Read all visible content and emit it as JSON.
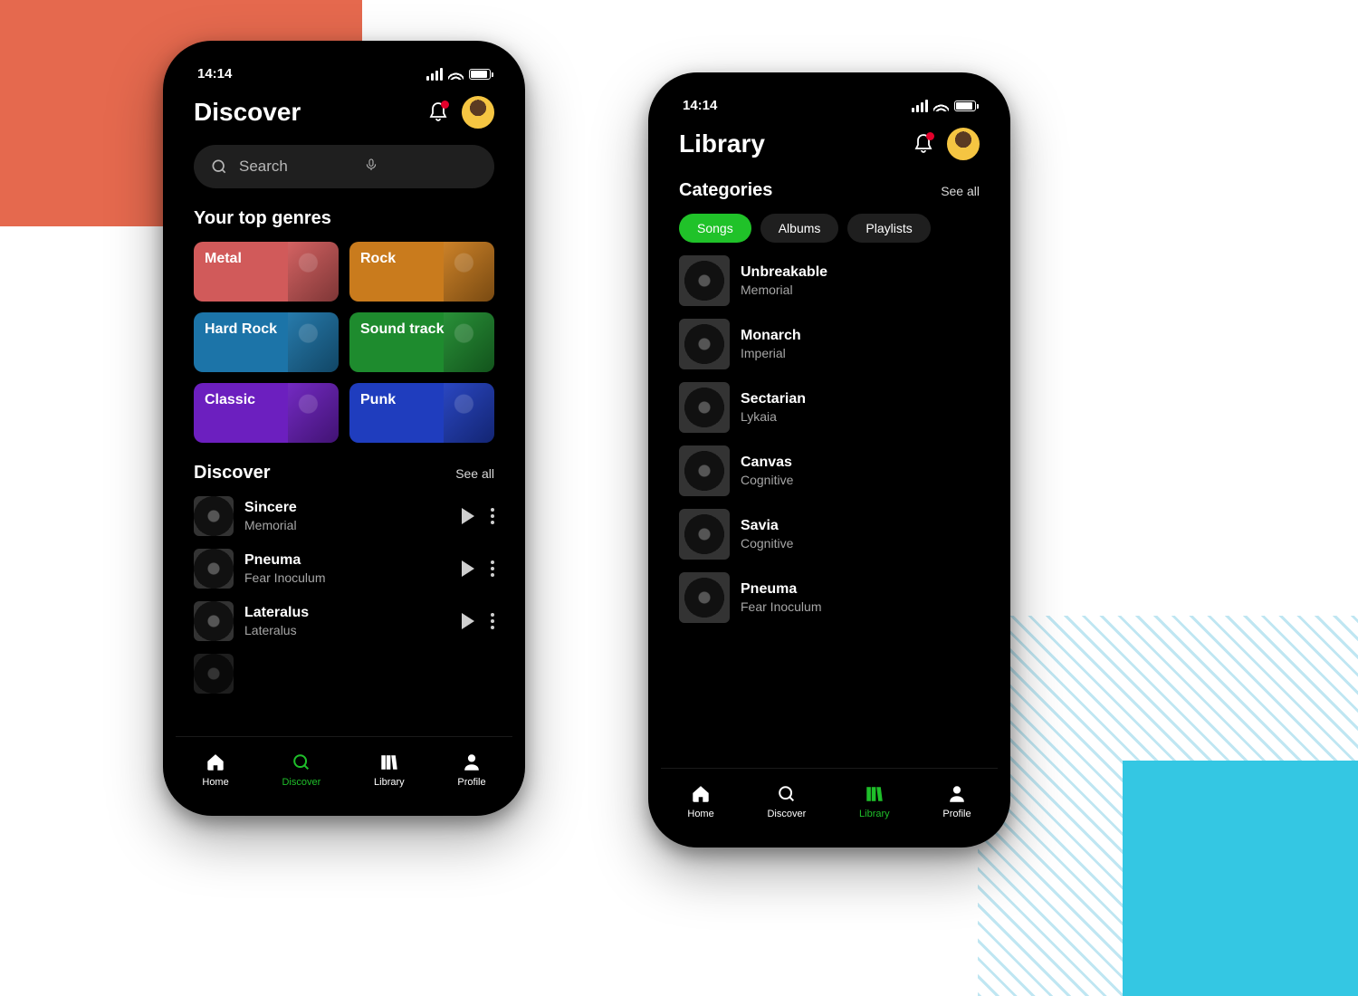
{
  "status": {
    "time": "14:14"
  },
  "colors": {
    "accent": "#20C229"
  },
  "discover": {
    "title": "Discover",
    "search_placeholder": "Search",
    "top_genres_label": "Your top genres",
    "discover_label": "Discover",
    "see_all": "See all",
    "genres": [
      {
        "label": "Metal",
        "color": "#D15A5A"
      },
      {
        "label": "Rock",
        "color": "#C97B1D"
      },
      {
        "label": "Hard Rock",
        "color": "#1C74A8"
      },
      {
        "label": "Sound track",
        "color": "#1E8B2E"
      },
      {
        "label": "Classic",
        "color": "#6C1FBF"
      },
      {
        "label": "Punk",
        "color": "#1F3DBE"
      }
    ],
    "tracks": [
      {
        "name": "Sincere",
        "artist": "Memorial"
      },
      {
        "name": "Pneuma",
        "artist": "Fear Inoculum"
      },
      {
        "name": "Lateralus",
        "artist": "Lateralus"
      }
    ]
  },
  "library": {
    "title": "Library",
    "section_label": "Categories",
    "see_all": "See all",
    "chips": [
      {
        "label": "Songs",
        "active": true
      },
      {
        "label": "Albums",
        "active": false
      },
      {
        "label": "Playlists",
        "active": false
      }
    ],
    "tracks": [
      {
        "name": "Unbreakable",
        "artist": "Memorial"
      },
      {
        "name": "Monarch",
        "artist": "Imperial"
      },
      {
        "name": "Sectarian",
        "artist": "Lykaia"
      },
      {
        "name": "Canvas",
        "artist": "Cognitive"
      },
      {
        "name": "Savia",
        "artist": "Cognitive"
      },
      {
        "name": "Pneuma",
        "artist": "Fear Inoculum"
      }
    ]
  },
  "nav": {
    "home": "Home",
    "discover": "Discover",
    "library": "Library",
    "profile": "Profile"
  }
}
